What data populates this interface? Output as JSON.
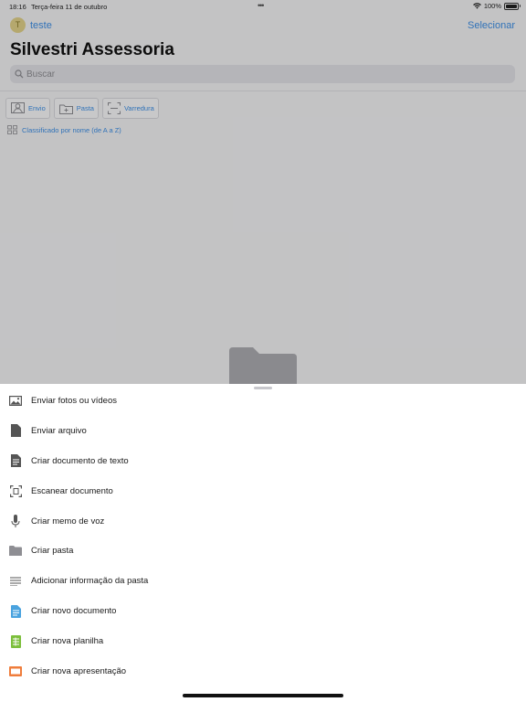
{
  "status_bar": {
    "time": "18:16",
    "date": "Terça-feira 11 de outubro",
    "dots": "•••",
    "battery": "100%"
  },
  "header": {
    "avatar_initial": "T",
    "account_name": "teste",
    "select_label": "Selecionar",
    "title": "Silvestri Assessoria"
  },
  "search": {
    "placeholder": "Buscar"
  },
  "toolbar": {
    "buttons": [
      {
        "label": "Envio",
        "icon": "upload-icon"
      },
      {
        "label": "Pasta",
        "icon": "new-folder-icon"
      },
      {
        "label": "Varredura",
        "icon": "scan-icon"
      }
    ],
    "sort_label": "Classificado por nome (de A a Z)"
  },
  "menu": {
    "items": [
      {
        "label": "Enviar fotos ou vídeos",
        "icon": "photo-icon"
      },
      {
        "label": "Enviar arquivo",
        "icon": "file-icon"
      },
      {
        "label": "Criar documento de texto",
        "icon": "text-document-icon"
      },
      {
        "label": "Escanear documento",
        "icon": "scan-document-icon"
      },
      {
        "label": "Criar memo de voz",
        "icon": "microphone-icon"
      },
      {
        "label": "Criar pasta",
        "icon": "folder-icon"
      },
      {
        "label": "Adicionar informação da pasta",
        "icon": "lines-icon"
      },
      {
        "label": "Criar novo documento",
        "icon": "word-document-icon"
      },
      {
        "label": "Criar nova planilha",
        "icon": "spreadsheet-icon"
      },
      {
        "label": "Criar nova apresentação",
        "icon": "presentation-icon"
      }
    ]
  },
  "colors": {
    "accent": "#3d8fe6",
    "doc_blue": "#4aa3df",
    "sheet_green": "#7cbf3c",
    "slides_orange": "#ef7d3c"
  }
}
